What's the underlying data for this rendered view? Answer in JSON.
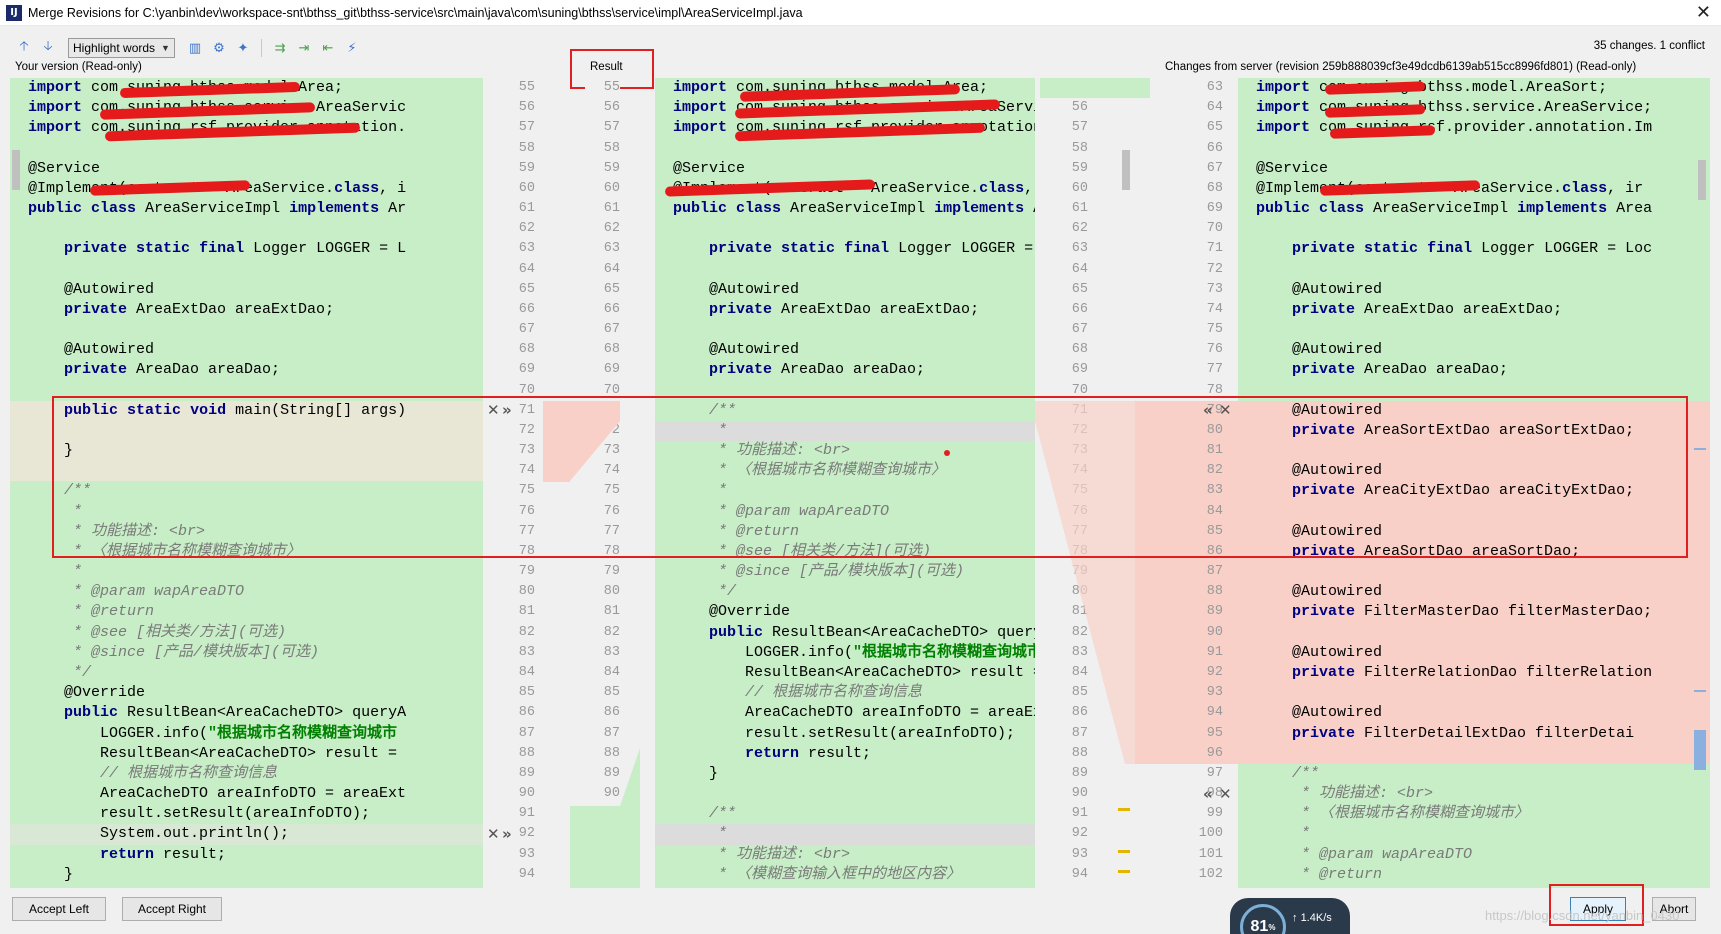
{
  "window": {
    "title": "Merge Revisions for C:\\yanbin\\dev\\workspace-snt\\bthss_git\\bthss-service\\src\\main\\java\\com\\suning\\bthss\\service\\impl\\AreaServiceImpl.java",
    "app_icon": "IJ"
  },
  "toolbar": {
    "highlight_mode": "Highlight words",
    "changes_summary": "35 changes. 1 conflict"
  },
  "panes": {
    "left_label": "Your version (Read-only)",
    "center_label": "Result",
    "right_label": "Changes from server (revision 259b888039cf3e49dcdb6139ab515cc8996fd801) (Read-only)"
  },
  "left_gutter": [
    "55",
    "56",
    "57",
    "58",
    "59",
    "60",
    "61",
    "62",
    "63",
    "64",
    "65",
    "66",
    "67",
    "68",
    "69",
    "70",
    "71",
    "72",
    "73",
    "74",
    "75",
    "76",
    "77",
    "78",
    "79",
    "80",
    "81",
    "82",
    "83",
    "84",
    "85",
    "86",
    "87",
    "88",
    "89",
    "90",
    "91",
    "92",
    "93",
    "94"
  ],
  "center_left_gutter": [
    "55",
    "56",
    "57",
    "58",
    "59",
    "60",
    "61",
    "62",
    "63",
    "64",
    "65",
    "66",
    "67",
    "68",
    "69",
    "70",
    "71",
    "72",
    "73",
    "74",
    "75",
    "76",
    "77",
    "78",
    "79",
    "80",
    "81",
    "82",
    "83",
    "84",
    "85",
    "86",
    "87",
    "88",
    "89",
    "90",
    "91",
    "92",
    "93",
    "94"
  ],
  "center_right_gutter": [
    "55",
    "56",
    "57",
    "58",
    "59",
    "60",
    "61",
    "62",
    "63",
    "64",
    "65",
    "66",
    "67",
    "68",
    "69",
    "70",
    "71",
    "72",
    "73",
    "74",
    "75",
    "76",
    "77",
    "78",
    "79",
    "80",
    "81",
    "82",
    "83",
    "84",
    "85",
    "86",
    "87",
    "88",
    "89",
    "90",
    "91",
    "92",
    "93",
    "94"
  ],
  "right_gutter": [
    "63",
    "64",
    "65",
    "66",
    "67",
    "68",
    "69",
    "70",
    "71",
    "72",
    "73",
    "74",
    "75",
    "76",
    "77",
    "78",
    "79",
    "80",
    "81",
    "82",
    "83",
    "84",
    "85",
    "86",
    "87",
    "88",
    "89",
    "90",
    "91",
    "92",
    "93",
    "94",
    "95",
    "96",
    "97",
    "98",
    "99",
    "100",
    "101",
    "102"
  ],
  "left_code": [
    "import com.suning.bthss.model.Area;",
    "import com.suning.bthss.service.AreaServic",
    "import com.suning.rsf.provider.annotation.",
    "",
    "@Service",
    "@Implement(contract = AreaService.class, i",
    "public class AreaServiceImpl implements Ar",
    "",
    "    private static final Logger LOGGER = L",
    "",
    "    @Autowired",
    "    private AreaExtDao areaExtDao;",
    "",
    "    @Autowired",
    "    private AreaDao areaDao;",
    "",
    "    public static void main(String[] args)",
    "",
    "    }",
    "",
    "    /**",
    "     *",
    "     * 功能描述: <br>",
    "     * 〈根据城市名称模糊查询城市〉",
    "     *",
    "     * @param wapAreaDTO",
    "     * @return",
    "     * @see [相关类/方法](可选)",
    "     * @since [产品/模块版本](可选)",
    "     */",
    "    @Override",
    "    public ResultBean<AreaCacheDTO> queryA",
    "        LOGGER.info(\"根据城市名称模糊查询城市",
    "        ResultBean<AreaCacheDTO> result =",
    "        // 根据城市名称查询信息",
    "        AreaCacheDTO areaInfoDTO = areaExt",
    "        result.setResult(areaInfoDTO);",
    "        System.out.println();",
    "        return result;",
    "    }"
  ],
  "center_code": [
    "import com.suning.bthss.model.Area;",
    "import com.suning.bthss.service.AreaService;",
    "import com.suning.rsf.provider.annotation.Imp",
    "",
    "@Service",
    "@Implement(contract = AreaService.class, imp",
    "public class AreaServiceImpl implements AreaS",
    "",
    "    private static final Logger LOGGER = Logg",
    "",
    "    @Autowired",
    "    private AreaExtDao areaExtDao;",
    "",
    "    @Autowired",
    "    private AreaDao areaDao;",
    "",
    "    /**",
    "     *",
    "     * 功能描述: <br>",
    "     * 〈根据城市名称模糊查询城市〉",
    "     *",
    "     * @param wapAreaDTO",
    "     * @return",
    "     * @see [相关类/方法](可选)",
    "     * @since [产品/模块版本](可选)",
    "     */",
    "    @Override",
    "    public ResultBean<AreaCacheDTO> queryArea",
    "        LOGGER.info(\"根据城市名称模糊查询城市:{}",
    "        ResultBean<AreaCacheDTO> result = new",
    "        // 根据城市名称查询信息",
    "        AreaCacheDTO areaInfoDTO = areaExtDao",
    "        result.setResult(areaInfoDTO);",
    "        return result;",
    "    }",
    "",
    "    /**",
    "     *",
    "     * 功能描述: <br>",
    "     * 〈模糊查询输入框中的地区内容〉"
  ],
  "right_code": [
    "import com.suning.bthss.model.AreaSort;",
    "import com.suning.bthss.service.AreaService;",
    "import com.suning.rsf.provider.annotation.Im",
    "",
    "@Service",
    "@Implement(contract = AreaService.class, ir",
    "public class AreaServiceImpl implements Area",
    "",
    "    private static final Logger LOGGER = Loc",
    "",
    "    @Autowired",
    "    private AreaExtDao areaExtDao;",
    "",
    "    @Autowired",
    "    private AreaDao areaDao;",
    "",
    "    @Autowired",
    "    private AreaSortExtDao areaSortExtDao;",
    "",
    "    @Autowired",
    "    private AreaCityExtDao areaCityExtDao;",
    "",
    "    @Autowired",
    "    private AreaSortDao areaSortDao;",
    "",
    "    @Autowired",
    "    private FilterMasterDao filterMasterDao;",
    "",
    "    @Autowired",
    "    private FilterRelationDao filterRelation",
    "",
    "    @Autowired",
    "    private FilterDetailExtDao filterDetai",
    "",
    "    /**",
    "     * 功能描述: <br>",
    "     * 〈根据城市名称模糊查询城市〉",
    "     *",
    "     * @param wapAreaDTO",
    "     * @return"
  ],
  "buttons": {
    "accept_left": "Accept Left",
    "accept_right": "Accept Right",
    "apply": "Apply",
    "abort": "Abort"
  },
  "network_widget": {
    "percent": "81",
    "unit": "%",
    "speed": "1.4K/s"
  },
  "watermark": "https://blog.csdn.net/yanbin_0430",
  "colors": {
    "added_bg": "#c8eec7",
    "conflict_bg": "#f8d0c8",
    "annotation_box": "#e02020",
    "keyword": "#000080"
  }
}
